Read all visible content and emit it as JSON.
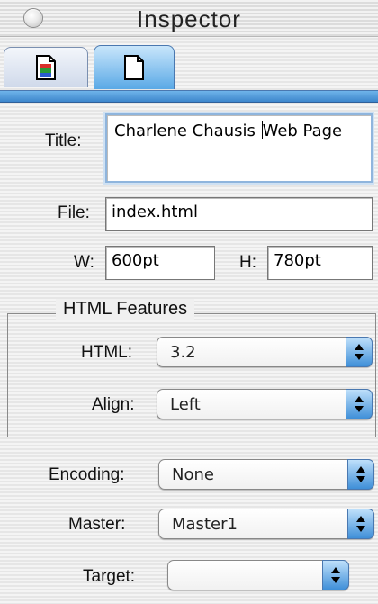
{
  "window": {
    "title": "Inspector"
  },
  "tabs": [
    {
      "name": "page-info-tab",
      "icon": "color-document-icon"
    },
    {
      "name": "document-tab",
      "icon": "document-icon"
    }
  ],
  "form": {
    "title": {
      "label": "Title:",
      "value_part1": "Charlene Chausis ",
      "value_part2": "Web Page"
    },
    "file": {
      "label": "File:",
      "value": "index.html"
    },
    "width": {
      "label": "W:",
      "value": "600pt"
    },
    "height": {
      "label": "H:",
      "value": "780pt"
    }
  },
  "html_features": {
    "title": "HTML Features",
    "html": {
      "label": "HTML:",
      "value": "3.2"
    },
    "align": {
      "label": "Align:",
      "value": "Left"
    }
  },
  "encoding": {
    "label": "Encoding:",
    "value": "None"
  },
  "master": {
    "label": "Master:",
    "value": "Master1"
  },
  "target": {
    "label": "Target:",
    "value": ""
  },
  "colors": {
    "accent": "#5aa9e6",
    "focus_ring": "#8fb5dd"
  }
}
